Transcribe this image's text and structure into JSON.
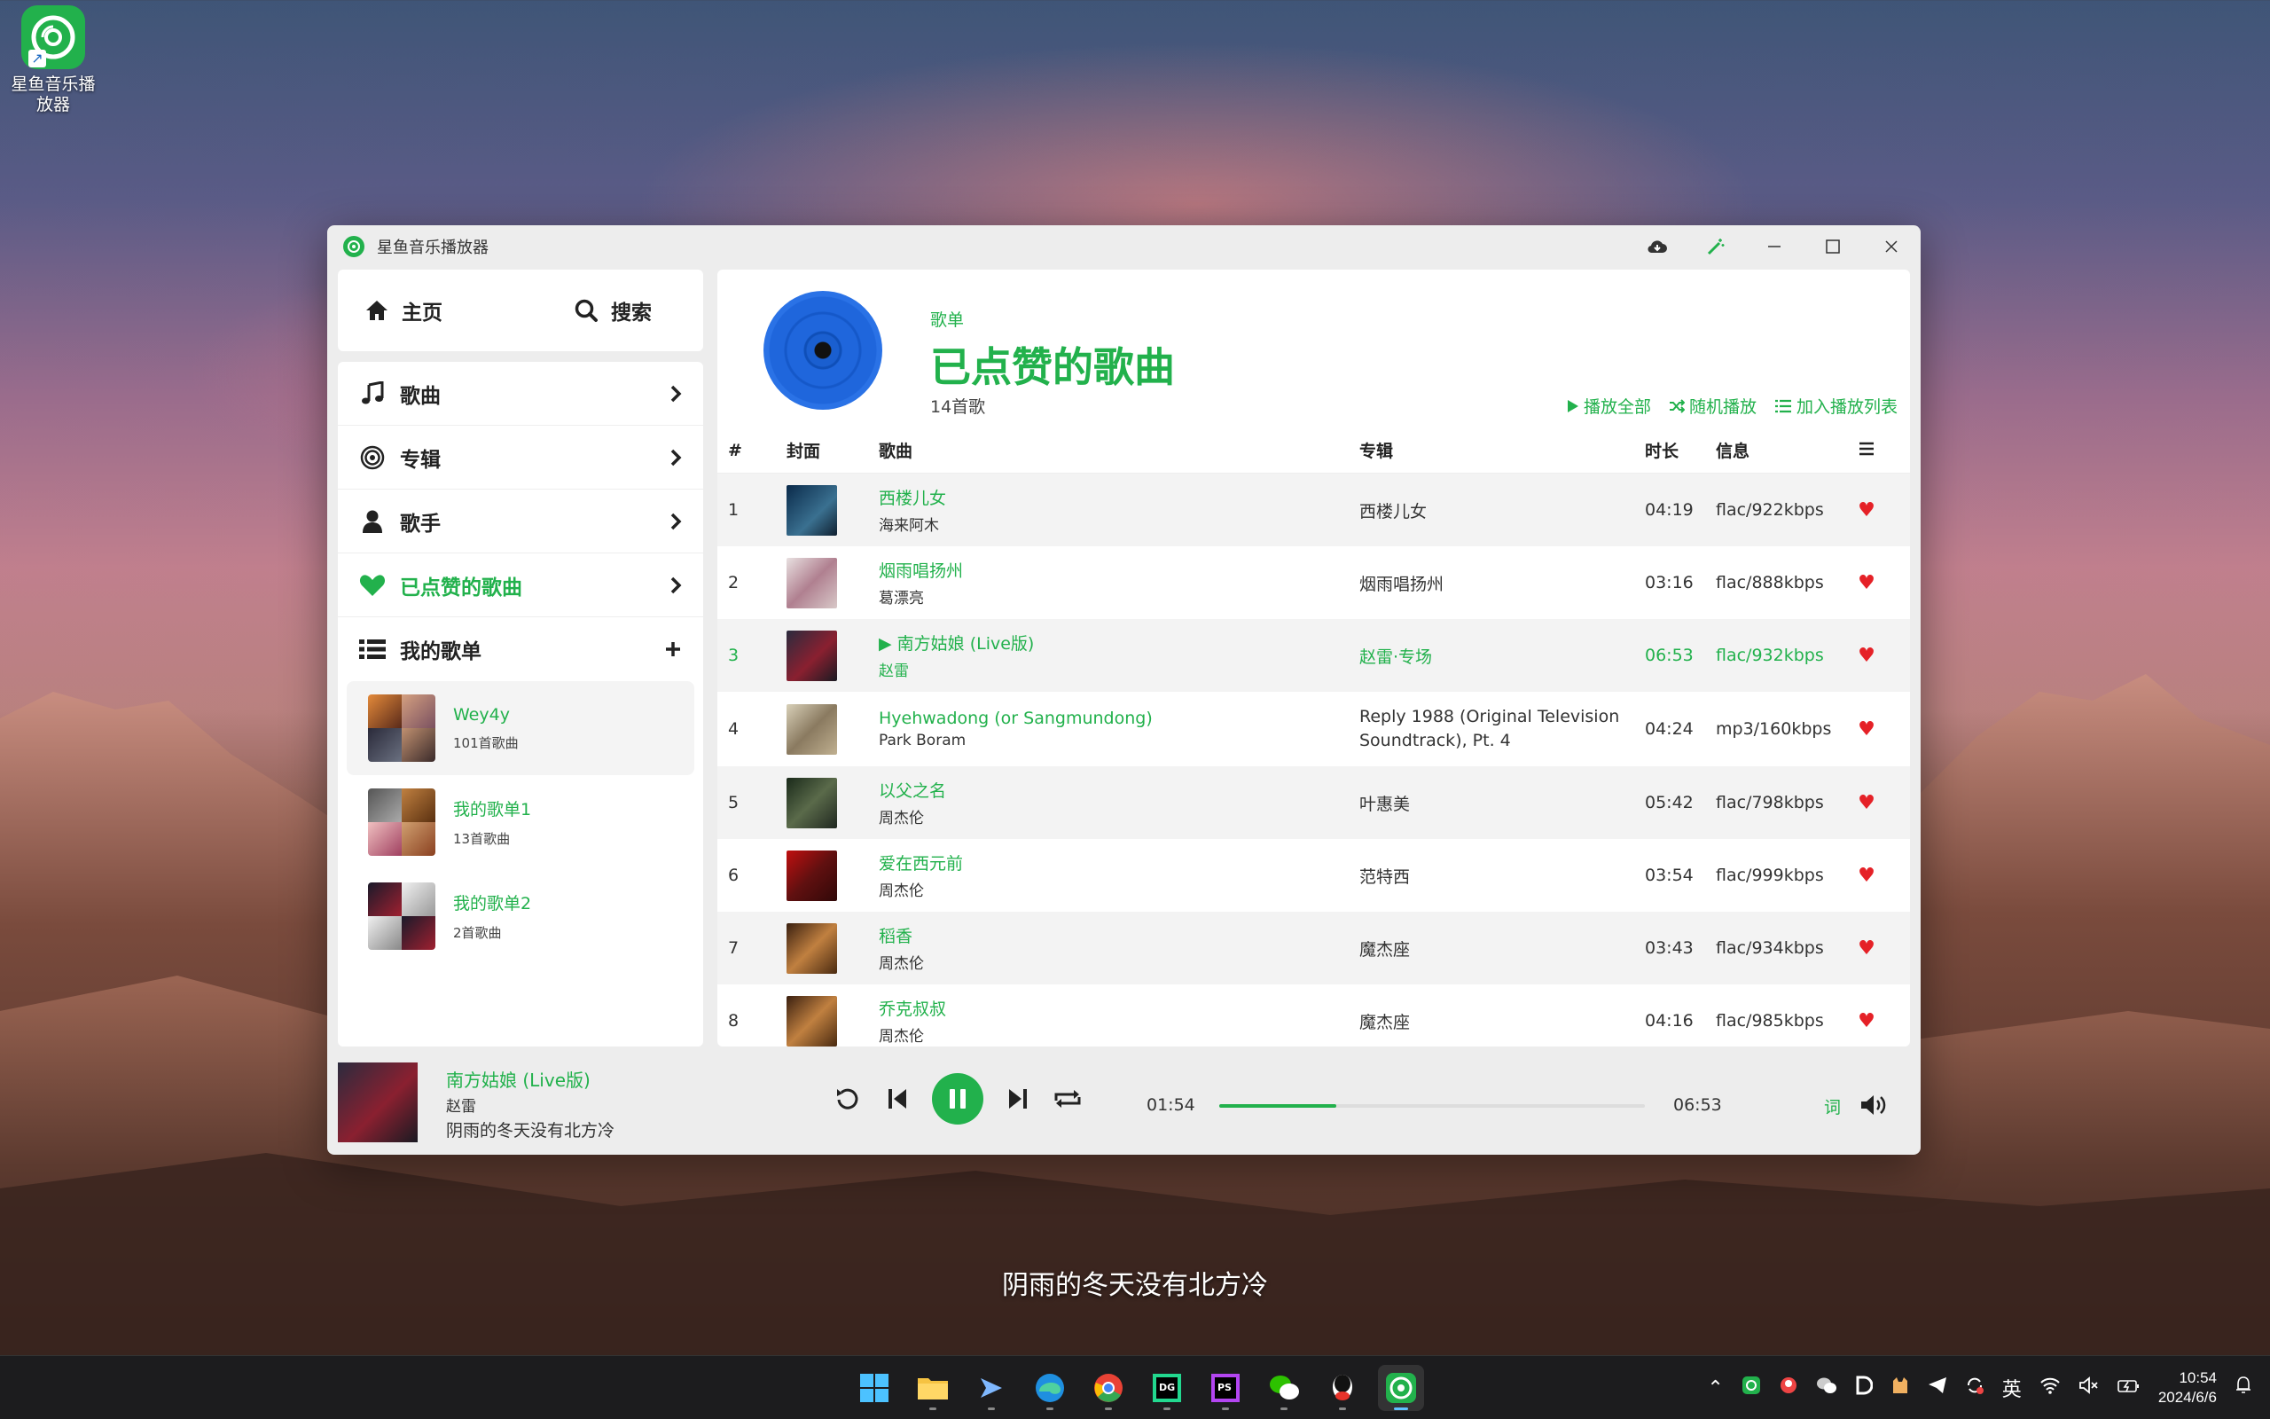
{
  "desktop": {
    "icon_label": "星鱼音乐播放器",
    "lyric": "阴雨的冬天没有北方冷"
  },
  "window": {
    "title": "星鱼音乐播放器"
  },
  "nav": {
    "home": "主页",
    "search": "搜索"
  },
  "sidebar": {
    "songs": "歌曲",
    "albums": "专辑",
    "artists": "歌手",
    "liked": "已点赞的歌曲",
    "my_playlists": "我的歌单",
    "playlists": [
      {
        "name": "Wey4y",
        "count": "101首歌曲"
      },
      {
        "name": "我的歌单1",
        "count": "13首歌曲"
      },
      {
        "name": "我的歌单2",
        "count": "2首歌曲"
      }
    ]
  },
  "header": {
    "kind": "歌单",
    "title": "已点赞的歌曲",
    "count": "14首歌",
    "play_all": "播放全部",
    "shuffle": "随机播放",
    "add_to_queue": "加入播放列表"
  },
  "table": {
    "headers": {
      "num": "#",
      "cover": "封面",
      "song": "歌曲",
      "album": "专辑",
      "duration": "时长",
      "info": "信息"
    },
    "rows": [
      {
        "num": "1",
        "title": "西楼儿女",
        "artist": "海来阿木",
        "album": "西楼儿女",
        "duration": "04:19",
        "info": "flac/922kbps"
      },
      {
        "num": "2",
        "title": "烟雨唱扬州",
        "artist": "葛漂亮",
        "album": "烟雨唱扬州",
        "duration": "03:16",
        "info": "flac/888kbps"
      },
      {
        "num": "3",
        "title": "▶ 南方姑娘 (Live版)",
        "artist": "赵雷",
        "album": "赵雷·专场",
        "duration": "06:53",
        "info": "flac/932kbps"
      },
      {
        "num": "4",
        "title": "Hyehwadong (or Sangmundong)",
        "artist": "Park Boram",
        "album": "Reply 1988 (Original Television Soundtrack), Pt. 4",
        "duration": "04:24",
        "info": "mp3/160kbps"
      },
      {
        "num": "5",
        "title": "以父之名",
        "artist": "周杰伦",
        "album": "叶惠美",
        "duration": "05:42",
        "info": "flac/798kbps"
      },
      {
        "num": "6",
        "title": "爱在西元前",
        "artist": "周杰伦",
        "album": "范特西",
        "duration": "03:54",
        "info": "flac/999kbps"
      },
      {
        "num": "7",
        "title": "稻香",
        "artist": "周杰伦",
        "album": "魔杰座",
        "duration": "03:43",
        "info": "flac/934kbps"
      },
      {
        "num": "8",
        "title": "乔克叔叔",
        "artist": "周杰伦",
        "album": "魔杰座",
        "duration": "04:16",
        "info": "flac/985kbps"
      }
    ]
  },
  "player": {
    "title": "南方姑娘 (Live版)",
    "artist": "赵雷",
    "lyric": "阴雨的冬天没有北方冷",
    "elapsed": "01:54",
    "total": "06:53",
    "progress": 0.276,
    "lyric_button": "词"
  },
  "taskbar": {
    "ime": "英",
    "time": "10:54",
    "date": "2024/6/6"
  },
  "colors": {
    "accent": "#22b14c",
    "heart": "#e52127"
  }
}
